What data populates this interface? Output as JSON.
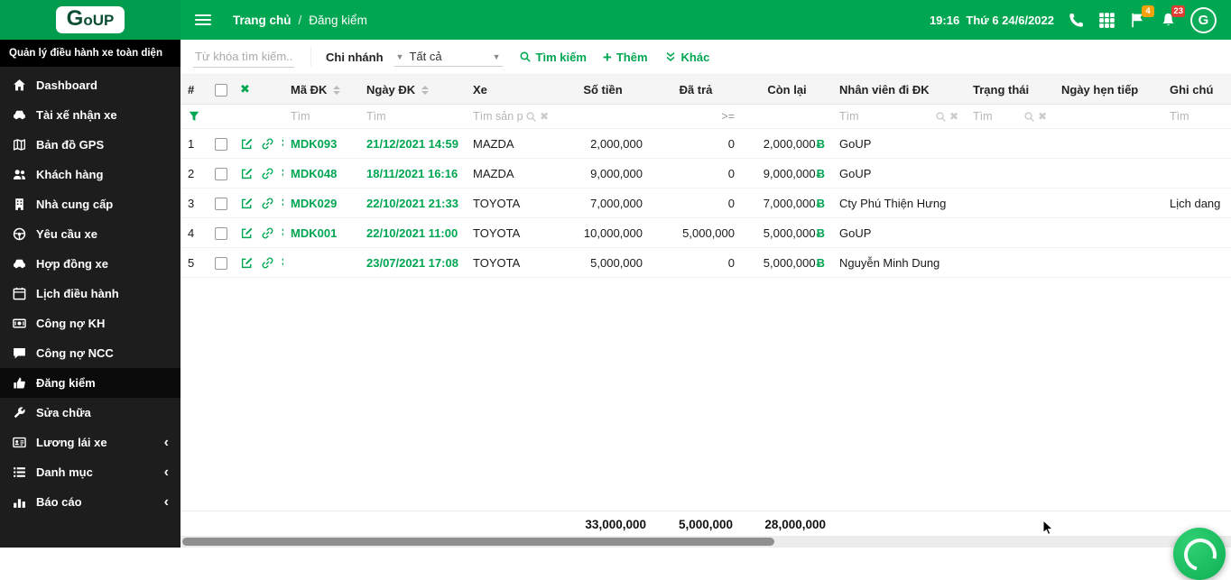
{
  "colors": {
    "accent_green": "#00a651",
    "badge_orange": "#f3a20c",
    "badge_red": "#e23c33"
  },
  "header": {
    "logo_g": "G",
    "logo_rest": "oUP",
    "breadcrumb_home": "Trang chủ",
    "breadcrumb_sep": "/",
    "breadcrumb_current": "Đăng kiểm",
    "datetime": "19:16  Thứ 6 24/6/2022",
    "flag_badge": "4",
    "bell_badge": "23",
    "avatar_letter": "G"
  },
  "sidebar": {
    "tagline": "Quản lý điều hành xe toàn diện",
    "items": [
      {
        "id": "dashboard",
        "label": "Dashboard",
        "icon": "home-icon",
        "active": false,
        "expandable": false
      },
      {
        "id": "tai-xe-nhan-xe",
        "label": "Tài xế nhận xe",
        "icon": "car-icon",
        "active": false,
        "expandable": false
      },
      {
        "id": "ban-do-gps",
        "label": "Bản đồ GPS",
        "icon": "map-icon",
        "active": false,
        "expandable": false
      },
      {
        "id": "khach-hang",
        "label": "Khách hàng",
        "icon": "users-icon",
        "active": false,
        "expandable": false
      },
      {
        "id": "nha-cung-cap",
        "label": "Nhà cung cấp",
        "icon": "building-icon",
        "active": false,
        "expandable": false
      },
      {
        "id": "yeu-cau-xe",
        "label": "Yêu cầu xe",
        "icon": "steering-wheel-icon",
        "active": false,
        "expandable": false
      },
      {
        "id": "hop-dong-xe",
        "label": "Hợp đồng xe",
        "icon": "car-icon",
        "active": false,
        "expandable": false
      },
      {
        "id": "lich-dieu-hanh",
        "label": "Lịch điều hành",
        "icon": "calendar-icon",
        "active": false,
        "expandable": false
      },
      {
        "id": "cong-no-kh",
        "label": "Công nợ KH",
        "icon": "money-icon",
        "active": false,
        "expandable": false
      },
      {
        "id": "cong-no-ncc",
        "label": "Công nợ NCC",
        "icon": "chat-icon",
        "active": false,
        "expandable": false
      },
      {
        "id": "dang-kiem",
        "label": "Đăng kiểm",
        "icon": "thumb-up-icon",
        "active": true,
        "expandable": false
      },
      {
        "id": "sua-chua",
        "label": "Sửa chữa",
        "icon": "wrench-icon",
        "active": false,
        "expandable": false
      },
      {
        "id": "luong-lai-xe",
        "label": "Lương lái xe",
        "icon": "id-card-icon",
        "active": false,
        "expandable": true
      },
      {
        "id": "danh-muc",
        "label": "Danh mục",
        "icon": "list-icon",
        "active": false,
        "expandable": true
      },
      {
        "id": "bao-cao",
        "label": "Báo cáo",
        "icon": "chart-icon",
        "active": false,
        "expandable": true
      }
    ]
  },
  "toolbar": {
    "keyword_placeholder": "Từ khóa tìm kiếm...",
    "branch_label": "Chi nhánh",
    "branch_value": "Tất cả",
    "search_label": "Tìm kiếm",
    "add_label": "Thêm",
    "other_label": "Khác"
  },
  "table": {
    "columns": [
      "#",
      "Mã ĐK",
      "Ngày ĐK",
      "Xe",
      "Số tiền",
      "Đã trả",
      "Còn lại",
      "Nhân viên đi ĐK",
      "Trạng thái",
      "Ngày hẹn tiếp",
      "Ghi chú"
    ],
    "filters": {
      "ma_dk": "Tìm",
      "ngay_dk": "Tìm",
      "xe": "Tìm sản ph",
      "da_tra_operator": ">=",
      "nhan_vien": "Tìm",
      "trang_thai": "Tìm",
      "ghi_chu": "Tìm"
    },
    "currency_symbol": "Ƀ",
    "rows": [
      {
        "index": "1",
        "code": "MDK093",
        "date": "21/12/2021 14:59",
        "vehicle": "MAZDA",
        "amount": "2,000,000",
        "paid": "0",
        "remaining": "2,000,000",
        "staff": "GoUP",
        "status": "",
        "next_date": "",
        "note": ""
      },
      {
        "index": "2",
        "code": "MDK048",
        "date": "18/11/2021 16:16",
        "vehicle": "MAZDA",
        "amount": "9,000,000",
        "paid": "0",
        "remaining": "9,000,000",
        "staff": "GoUP",
        "status": "",
        "next_date": "",
        "note": ""
      },
      {
        "index": "3",
        "code": "MDK029",
        "date": "22/10/2021 21:33",
        "vehicle": "TOYOTA",
        "amount": "7,000,000",
        "paid": "0",
        "remaining": "7,000,000",
        "staff": "Cty Phú Thiện Hưng",
        "status": "",
        "next_date": "",
        "note": "Lịch dang"
      },
      {
        "index": "4",
        "code": "MDK001",
        "date": "22/10/2021 11:00",
        "vehicle": "TOYOTA",
        "amount": "10,000,000",
        "paid": "5,000,000",
        "remaining": "5,000,000",
        "staff": "GoUP",
        "status": "",
        "next_date": "",
        "note": ""
      },
      {
        "index": "5",
        "code": "",
        "date": "23/07/2021 17:08",
        "vehicle": "TOYOTA",
        "amount": "5,000,000",
        "paid": "0",
        "remaining": "5,000,000",
        "staff": "Nguyễn Minh Dung",
        "status": "",
        "next_date": "",
        "note": ""
      }
    ],
    "totals": {
      "amount": "33,000,000",
      "paid": "5,000,000",
      "remaining": "28,000,000"
    }
  }
}
